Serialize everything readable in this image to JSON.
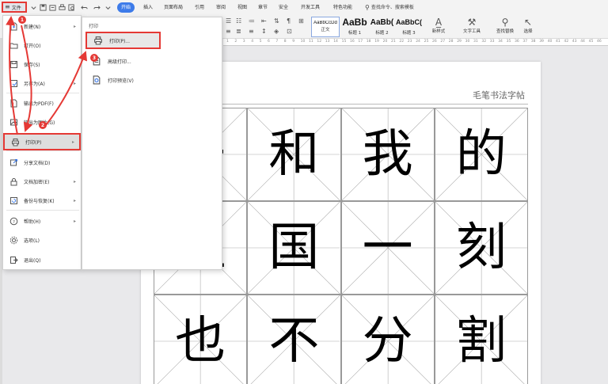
{
  "colors": {
    "accent": "#3d7be9",
    "highlight": "#e53935",
    "page_bg": "#e9e9eb"
  },
  "menubar": {
    "file_label": "文件",
    "tabs": [
      "开始",
      "插入",
      "页面布局",
      "引用",
      "审阅",
      "视图",
      "章节",
      "安全",
      "开发工具",
      "特色功能"
    ],
    "search_text": "查找命令、搜索模板"
  },
  "ribbon": {
    "styles": [
      {
        "sample": "AaBbCcDd",
        "caption": "正文"
      },
      {
        "sample": "AaBb",
        "caption": "标题 1"
      },
      {
        "sample": "AaBb(",
        "caption": "标题 2"
      },
      {
        "sample": "AaBbC(",
        "caption": "标题 3"
      }
    ],
    "new_style": "新样式",
    "text_tools": "文字工具",
    "find_replace": "查找替换",
    "select": "选择"
  },
  "ruler": [
    "1",
    "2",
    "3",
    "4",
    "5",
    "6",
    "7",
    "8",
    "9",
    "10",
    "11",
    "12",
    "13",
    "14",
    "15",
    "16",
    "17",
    "18",
    "19",
    "20",
    "21",
    "22",
    "23",
    "24",
    "25",
    "26",
    "27",
    "28",
    "29",
    "30",
    "31",
    "32",
    "33",
    "34",
    "35",
    "36",
    "37",
    "38",
    "39",
    "40",
    "41",
    "42",
    "43",
    "44",
    "45",
    "46"
  ],
  "file_menu": {
    "items": [
      {
        "label": "新建(N)",
        "icon": "new-doc-icon",
        "arrow": true
      },
      {
        "label": "打开(O)",
        "icon": "folder-icon",
        "arrow": false
      },
      {
        "label": "保存(S)",
        "icon": "save-icon",
        "arrow": false
      },
      {
        "label": "另存为(A)",
        "icon": "save-as-icon",
        "arrow": true
      },
      {
        "label": "输出为PDF(F)",
        "icon": "pdf-icon",
        "arrow": false
      },
      {
        "label": "输出为图片(G)",
        "icon": "image-icon",
        "arrow": false
      },
      {
        "label": "打印(P)",
        "icon": "printer-icon",
        "arrow": true
      },
      {
        "label": "分享文档(D)",
        "icon": "share-icon",
        "arrow": false
      },
      {
        "label": "文档加密(E)",
        "icon": "lock-icon",
        "arrow": true
      },
      {
        "label": "备份与恢复(K)",
        "icon": "backup-icon",
        "arrow": true
      },
      {
        "label": "帮助(H)",
        "icon": "help-icon",
        "arrow": true
      },
      {
        "label": "选项(L)",
        "icon": "gear-icon",
        "arrow": false
      },
      {
        "label": "退出(Q)",
        "icon": "exit-icon",
        "arrow": false
      }
    ]
  },
  "print_submenu": {
    "title": "打印",
    "items": [
      {
        "label": "打印(P)...",
        "icon": "printer-icon"
      },
      {
        "label": "高级打印...",
        "icon": "advanced-print-icon"
      },
      {
        "label": "打印预览(V)",
        "icon": "print-preview-icon"
      }
    ]
  },
  "document": {
    "header": "毛笔书法字帖",
    "grid_chars": [
      "去",
      "和",
      "我",
      "的",
      "祖",
      "国",
      "一",
      "刻",
      "也",
      "不",
      "分",
      "割"
    ]
  },
  "annotations": {
    "badges": [
      "1",
      "2",
      "3"
    ]
  }
}
